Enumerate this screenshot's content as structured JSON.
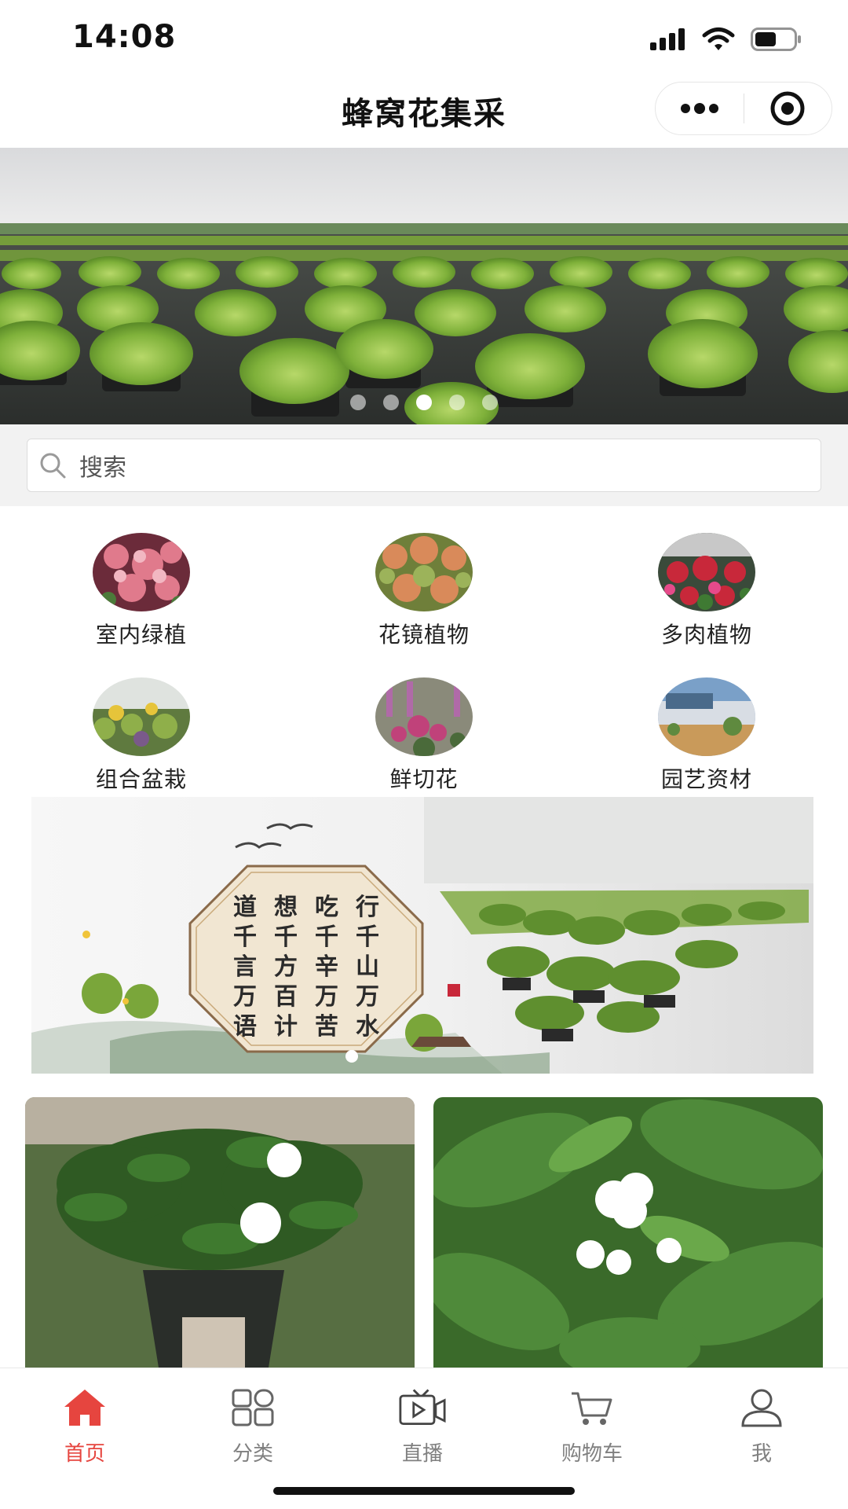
{
  "status_bar": {
    "time": "14:08",
    "icons": [
      "signal-icon",
      "wifi-icon",
      "battery-icon"
    ]
  },
  "nav": {
    "title": "蜂窝花集采",
    "capsule": [
      "more-dots-icon",
      "record-target-icon"
    ]
  },
  "banner": {
    "slide_count": 5,
    "active_slide": 3,
    "image": "potted plant nursery rows"
  },
  "search": {
    "placeholder": "搜索"
  },
  "categories": [
    {
      "label": "室内绿植",
      "icon": "indoor-plant-image"
    },
    {
      "label": "花镜植物",
      "icon": "border-plant-image"
    },
    {
      "label": "多肉植物",
      "icon": "succulent-image"
    },
    {
      "label": "组合盆栽",
      "icon": "combo-pot-image"
    },
    {
      "label": "鲜切花",
      "icon": "cut-flower-image"
    },
    {
      "label": "园艺资材",
      "icon": "garden-supplies-image"
    }
  ],
  "promo": {
    "poem_lines": [
      "行千山万水",
      "吃千辛万苦",
      "想千方百计",
      "道千言万语"
    ],
    "slide_count": 1,
    "active_slide": 1
  },
  "products": [
    {
      "image": "gardenia-potted-image"
    },
    {
      "image": "jasmine-flower-image"
    }
  ],
  "tabs": [
    {
      "label": "首页",
      "icon": "home-icon",
      "active": true
    },
    {
      "label": "分类",
      "icon": "category-icon",
      "active": false
    },
    {
      "label": "直播",
      "icon": "live-tv-icon",
      "active": false
    },
    {
      "label": "购物车",
      "icon": "cart-icon",
      "active": false
    },
    {
      "label": "我",
      "icon": "user-icon",
      "active": false
    }
  ],
  "colors": {
    "accent": "#e6453f",
    "tab_inactive": "#808080",
    "search_bg": "#f2f2f2"
  }
}
